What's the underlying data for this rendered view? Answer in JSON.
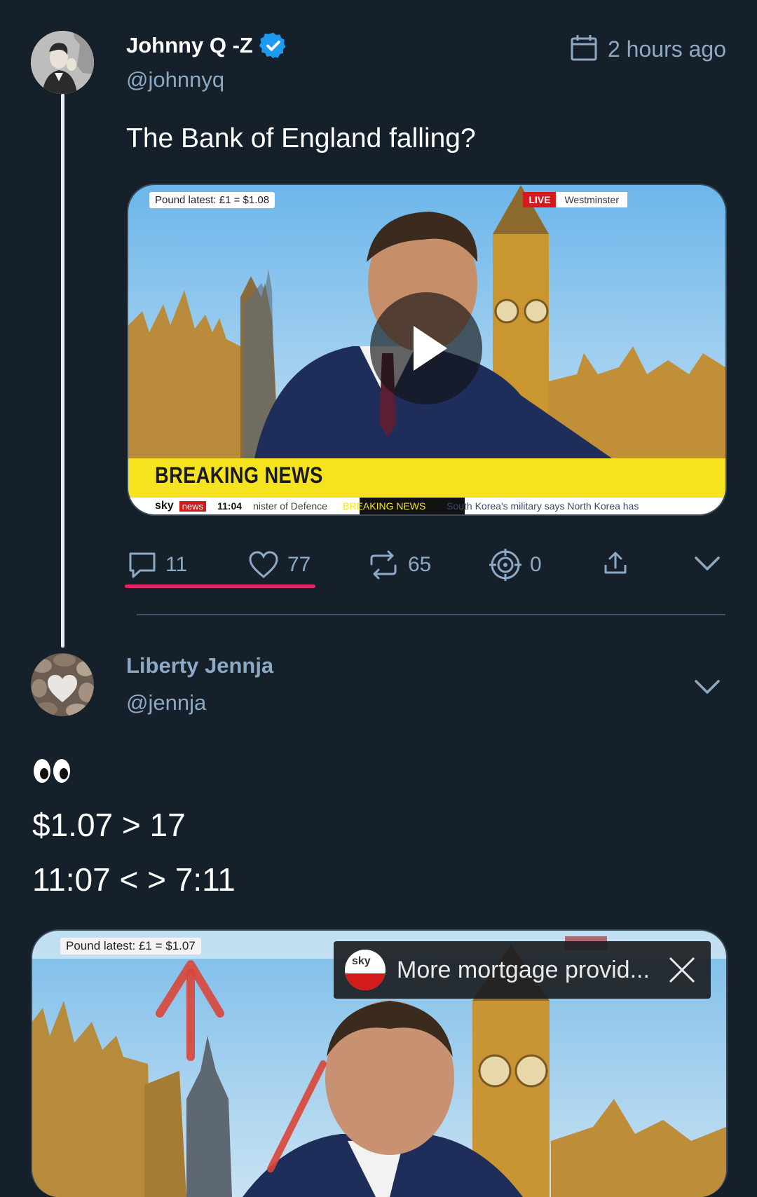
{
  "tweet": {
    "author_name": "Johnny Q -Z",
    "author_handle": "@johnnyq",
    "timestamp": "2 hours ago",
    "text": "The Bank of England falling?",
    "media": {
      "ticker_top": "Pound latest: £1 = $1.08",
      "live_badge": "LIVE",
      "location": "Westminster",
      "breaking_banner": "BREAKING NEWS",
      "channel_sky": "sky",
      "channel_news": "news",
      "clock": "11:04",
      "ticker_left": "nister of Defence",
      "ticker_badge": "BREAKING NEWS",
      "ticker_right": "South Korea's military says North Korea has"
    },
    "actions": {
      "replies": "11",
      "likes": "77",
      "retweets": "65",
      "target": "0"
    },
    "underline_color": "#e0245e"
  },
  "reply": {
    "author_name": "Liberty Jennja",
    "author_handle": "@jennja",
    "emoji": "👀",
    "line1": "$1.07 > 17",
    "line2": "11:07 < > 7:11",
    "media": {
      "ticker_top": "Pound latest: £1 = $1.07",
      "notification_logo": "sky",
      "notification_text": "More mortgage provid..."
    }
  },
  "colors": {
    "background": "#15202b",
    "handle": "#8ea9c4",
    "verified": "#1d9bf0",
    "breaking_yellow": "#f4e31e",
    "arrow_red": "#d9463a"
  }
}
